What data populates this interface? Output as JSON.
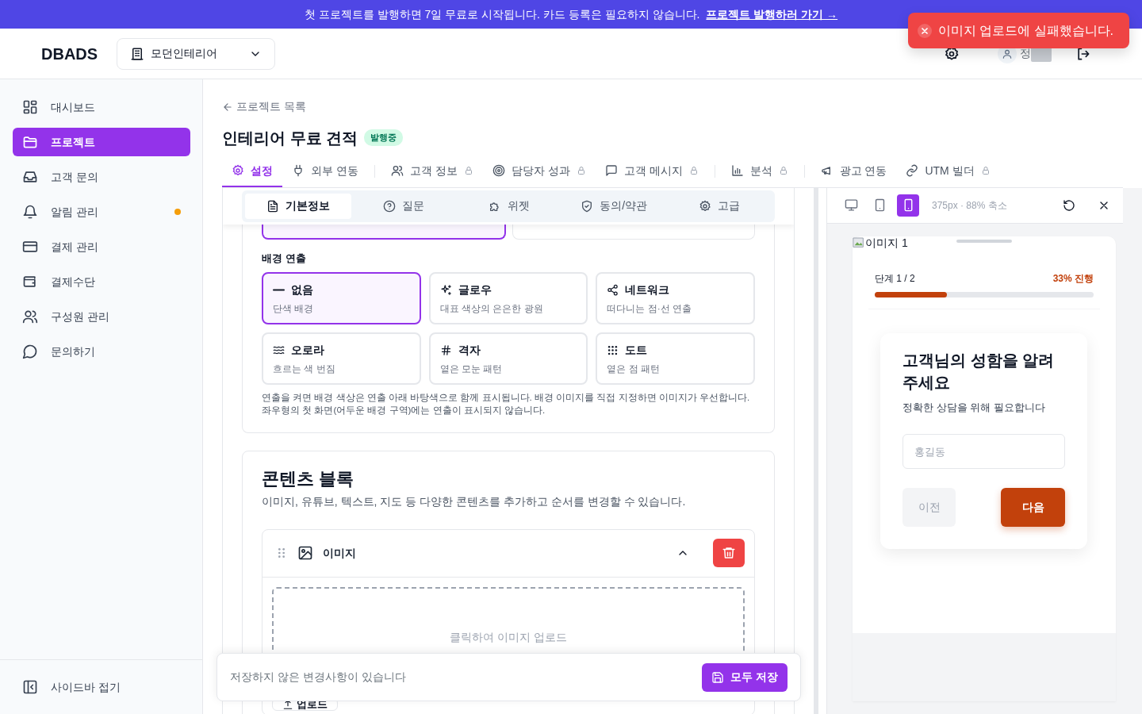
{
  "banner": {
    "text": "첫 프로젝트를 발행하면 7일 무료로 시작됩니다. 카드 등록은 필요하지 않습니다.",
    "link": "프로젝트 발행하러 가기 →"
  },
  "toast": {
    "kind": "error",
    "message": "이미지 업로드에 실패했습니다."
  },
  "header": {
    "logo": "DBADS",
    "workspace": "모던인테리어",
    "user_name": "정"
  },
  "sidebar": {
    "items": [
      {
        "label": "대시보드",
        "selected": false,
        "notification": false
      },
      {
        "label": "프로젝트",
        "selected": true,
        "notification": false
      },
      {
        "label": "고객 문의",
        "selected": false,
        "notification": false
      },
      {
        "label": "알림 관리",
        "selected": false,
        "notification": true
      },
      {
        "label": "결제 관리",
        "selected": false,
        "notification": false
      },
      {
        "label": "결제수단",
        "selected": false,
        "notification": false
      },
      {
        "label": "구성원 관리",
        "selected": false,
        "notification": false
      },
      {
        "label": "문의하기",
        "selected": false,
        "notification": false
      }
    ],
    "collapse": "사이드바 접기"
  },
  "page": {
    "back": "프로젝트 목록",
    "title": "인테리어 무료 견적",
    "status": "발행중"
  },
  "tab_groups": [
    [
      {
        "label": "설정",
        "selected": true,
        "locked": false
      },
      {
        "label": "외부 연동",
        "selected": false,
        "locked": false
      }
    ],
    [
      {
        "label": "고객 정보",
        "selected": false,
        "locked": true
      },
      {
        "label": "담당자 성과",
        "selected": false,
        "locked": true
      },
      {
        "label": "고객 메시지",
        "selected": false,
        "locked": true
      }
    ],
    [
      {
        "label": "분석",
        "selected": false,
        "locked": true
      }
    ],
    [
      {
        "label": "광고 연동",
        "selected": false,
        "locked": false
      },
      {
        "label": "UTM 빌더",
        "selected": false,
        "locked": true
      }
    ]
  ],
  "sub_tabs": [
    {
      "label": "기본정보",
      "selected": true
    },
    {
      "label": "질문",
      "selected": false
    },
    {
      "label": "위젯",
      "selected": false
    },
    {
      "label": "동의/약관",
      "selected": false
    },
    {
      "label": "고급",
      "selected": false
    }
  ],
  "background_effect": {
    "label": "배경 연출",
    "options": [
      {
        "title": "없음",
        "description": "단색 배경",
        "selected": true
      },
      {
        "title": "글로우",
        "description": "대표 색상의 은은한 광원",
        "selected": false
      },
      {
        "title": "네트워크",
        "description": "떠다니는 점·선 연출",
        "selected": false
      },
      {
        "title": "오로라",
        "description": "흐르는 색 번짐",
        "selected": false
      },
      {
        "title": "격자",
        "description": "옅은 모눈 패턴",
        "selected": false
      },
      {
        "title": "도트",
        "description": "옅은 점 패턴",
        "selected": false
      }
    ],
    "note": "연출을 켜면 배경 색상은 연출 아래 바탕색으로 함께 표시됩니다. 배경 이미지를 직접 지정하면 이미지가 우선합니다. 좌우형의 첫 화면(어두운 배경 구역)에는 연출이 표시되지 않습니다."
  },
  "content_blocks": {
    "title": "콘텐츠 블록",
    "description": "이미지, 유튜브, 텍스트, 지도 등 다양한 콘텐츠를 추가하고 순서를 변경할 수 있습니다.",
    "blocks": [
      {
        "label": "이미지",
        "expanded": true,
        "upload_hint": "클릭하여 이미지 업로드",
        "upload_button": "업로드"
      }
    ]
  },
  "save_bar": {
    "message": "저장하지 않은 변경사항이 있습니다",
    "button": "모두 저장"
  },
  "preview": {
    "devices": [
      {
        "kind": "desktop",
        "selected": false
      },
      {
        "kind": "tablet",
        "selected": false
      },
      {
        "kind": "mobile",
        "selected": true
      }
    ],
    "size_label": "375px · 88% 축소",
    "image_alt": "이미지 1",
    "step": "단계 1 / 2",
    "progress_text": "33% 진행",
    "progress": {
      "level": 0.33
    },
    "question": "고객님의 성함을 알려주세요",
    "hint": "정확한 상담을 위해 필요합니다",
    "placeholder": "홍길동",
    "prev": "이전",
    "next": "다음"
  }
}
